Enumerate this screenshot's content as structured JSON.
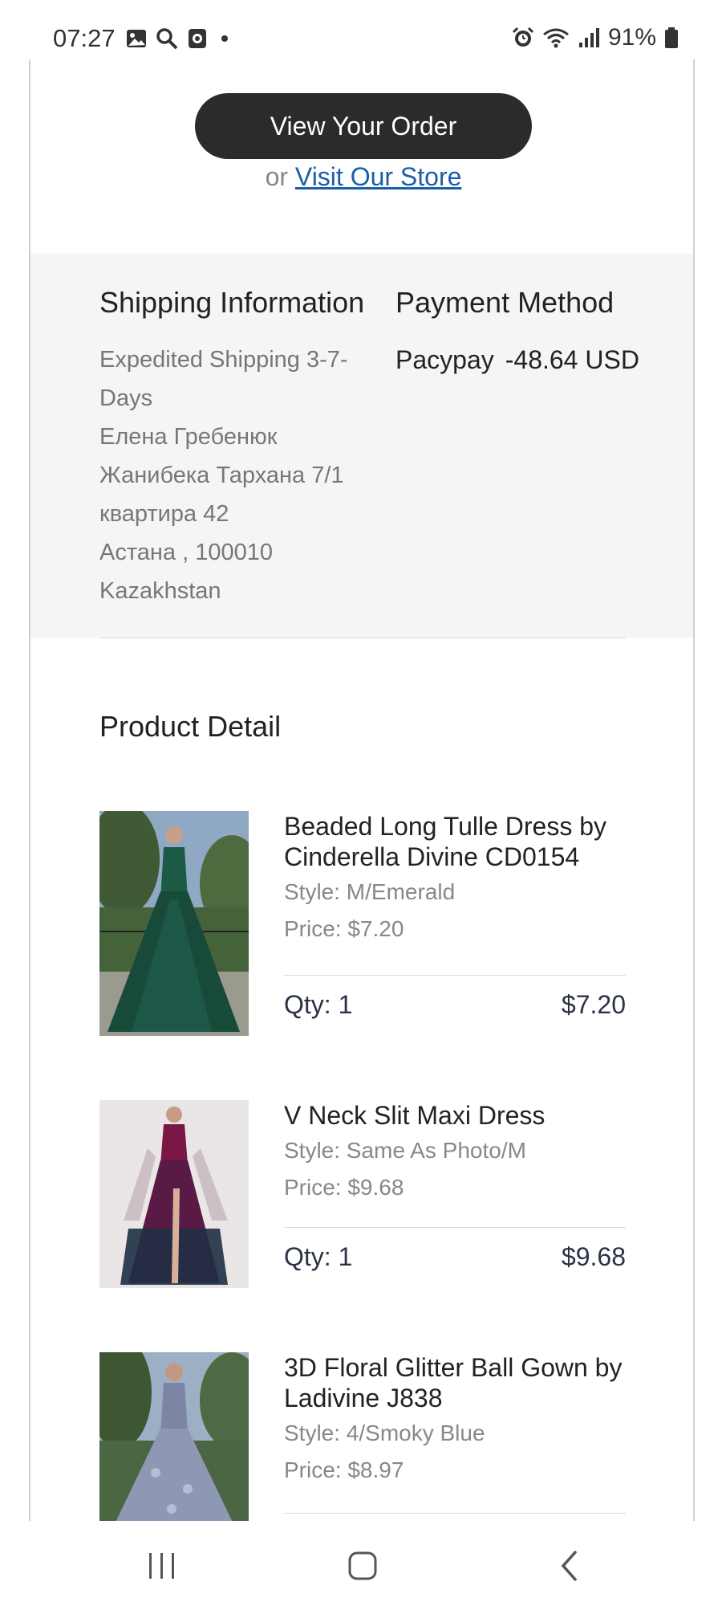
{
  "status_bar": {
    "time": "07:27",
    "battery": "91%",
    "left_icons": [
      "image-icon",
      "search-icon",
      "screen-record-icon",
      "dot-icon"
    ],
    "right_icons": [
      "alarm-icon",
      "wifi-icon",
      "signal-icon",
      "battery-icon"
    ]
  },
  "order_actions": {
    "view_order_label": "View Your Order",
    "or_text": "or",
    "visit_store_label": "Visit Our Store"
  },
  "shipping": {
    "title": "Shipping Information",
    "lines": [
      "Expedited Shipping 3-7-Days",
      "Елена Гребенюк",
      "Жанибека Тархана 7/1",
      "квартира 42",
      "Астана , 100010",
      "Kazakhstan"
    ]
  },
  "payment": {
    "title": "Payment Method",
    "method": "Pacypay",
    "amount": "-48.64 USD"
  },
  "product_detail": {
    "title": "Product Detail",
    "items": [
      {
        "name": "Beaded Long Tulle Dress by Cinderella Divine CD0154",
        "style": "Style: M/Emerald",
        "price": "Price: $7.20",
        "qty": "Qty: 1",
        "total": "$7.20",
        "image_colors": {
          "bg": "#5d7a55",
          "dress": "#184a3a"
        }
      },
      {
        "name": "V Neck Slit Maxi Dress",
        "style": "Style: Same As Photo/M",
        "price": "Price: $9.68",
        "qty": "Qty: 1",
        "total": "$9.68",
        "image_colors": {
          "bg": "#e8e4e4",
          "dress": "#7b1744"
        }
      },
      {
        "name": "3D Floral Glitter Ball Gown by Ladivine J838",
        "style": "Style: 4/Smoky Blue",
        "price": "Price: $8.97",
        "qty": "",
        "total": "",
        "image_colors": {
          "bg": "#4f6a48",
          "dress": "#8e98b4"
        }
      }
    ]
  },
  "nav_bar": {
    "icons": [
      "recent-apps-icon",
      "home-icon",
      "back-icon"
    ]
  }
}
